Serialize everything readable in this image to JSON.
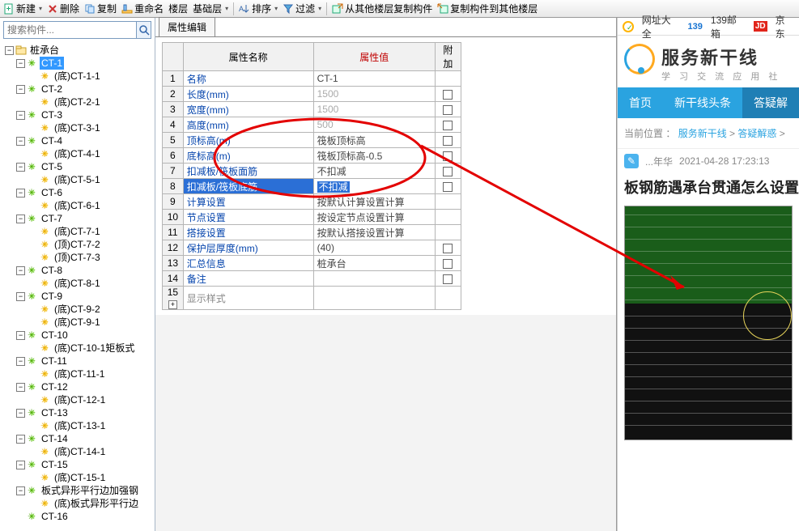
{
  "toolbar": {
    "new": "新建",
    "delete": "删除",
    "copy": "复制",
    "rename": "重命名",
    "floor": "楼层",
    "base_layer": "基础层",
    "sort": "排序",
    "filter": "过滤",
    "copy_from_other": "从其他楼层复制构件",
    "copy_to_other": "复制构件到其他楼层"
  },
  "search_placeholder": "搜索构件...",
  "tree_root": "桩承台",
  "tree": [
    {
      "lvl": 1,
      "tw": "-",
      "ic": "green",
      "label": "CT-1",
      "sel": true
    },
    {
      "lvl": 2,
      "tw": "",
      "ic": "orange",
      "label": "(底)CT-1-1"
    },
    {
      "lvl": 1,
      "tw": "-",
      "ic": "green",
      "label": "CT-2"
    },
    {
      "lvl": 2,
      "tw": "",
      "ic": "orange",
      "label": "(底)CT-2-1"
    },
    {
      "lvl": 1,
      "tw": "-",
      "ic": "green",
      "label": "CT-3"
    },
    {
      "lvl": 2,
      "tw": "",
      "ic": "orange",
      "label": "(底)CT-3-1"
    },
    {
      "lvl": 1,
      "tw": "-",
      "ic": "green",
      "label": "CT-4"
    },
    {
      "lvl": 2,
      "tw": "",
      "ic": "orange",
      "label": "(底)CT-4-1"
    },
    {
      "lvl": 1,
      "tw": "-",
      "ic": "green",
      "label": "CT-5"
    },
    {
      "lvl": 2,
      "tw": "",
      "ic": "orange",
      "label": "(底)CT-5-1"
    },
    {
      "lvl": 1,
      "tw": "-",
      "ic": "green",
      "label": "CT-6"
    },
    {
      "lvl": 2,
      "tw": "",
      "ic": "orange",
      "label": "(底)CT-6-1"
    },
    {
      "lvl": 1,
      "tw": "-",
      "ic": "green",
      "label": "CT-7"
    },
    {
      "lvl": 2,
      "tw": "",
      "ic": "orange",
      "label": "(底)CT-7-1"
    },
    {
      "lvl": 2,
      "tw": "",
      "ic": "orange",
      "label": "(顶)CT-7-2"
    },
    {
      "lvl": 2,
      "tw": "",
      "ic": "orange",
      "label": "(顶)CT-7-3"
    },
    {
      "lvl": 1,
      "tw": "-",
      "ic": "green",
      "label": "CT-8"
    },
    {
      "lvl": 2,
      "tw": "",
      "ic": "orange",
      "label": "(底)CT-8-1"
    },
    {
      "lvl": 1,
      "tw": "-",
      "ic": "green",
      "label": "CT-9"
    },
    {
      "lvl": 2,
      "tw": "",
      "ic": "orange",
      "label": "(底)CT-9-2"
    },
    {
      "lvl": 2,
      "tw": "",
      "ic": "orange",
      "label": "(底)CT-9-1"
    },
    {
      "lvl": 1,
      "tw": "-",
      "ic": "green",
      "label": "CT-10"
    },
    {
      "lvl": 2,
      "tw": "",
      "ic": "orange",
      "label": "(底)CT-10-1矩板式"
    },
    {
      "lvl": 1,
      "tw": "-",
      "ic": "green",
      "label": "CT-11"
    },
    {
      "lvl": 2,
      "tw": "",
      "ic": "orange",
      "label": "(底)CT-11-1"
    },
    {
      "lvl": 1,
      "tw": "-",
      "ic": "green",
      "label": "CT-12"
    },
    {
      "lvl": 2,
      "tw": "",
      "ic": "orange",
      "label": "(底)CT-12-1"
    },
    {
      "lvl": 1,
      "tw": "-",
      "ic": "green",
      "label": "CT-13"
    },
    {
      "lvl": 2,
      "tw": "",
      "ic": "orange",
      "label": "(底)CT-13-1"
    },
    {
      "lvl": 1,
      "tw": "-",
      "ic": "green",
      "label": "CT-14"
    },
    {
      "lvl": 2,
      "tw": "",
      "ic": "orange",
      "label": "(底)CT-14-1"
    },
    {
      "lvl": 1,
      "tw": "-",
      "ic": "green",
      "label": "CT-15"
    },
    {
      "lvl": 2,
      "tw": "",
      "ic": "orange",
      "label": "(底)CT-15-1"
    },
    {
      "lvl": 1,
      "tw": "-",
      "ic": "green",
      "label": "板式异形平行边加强钢"
    },
    {
      "lvl": 2,
      "tw": "",
      "ic": "orange",
      "label": "(底)板式异形平行边"
    },
    {
      "lvl": 1,
      "tw": "",
      "ic": "green",
      "label": "CT-16"
    }
  ],
  "tab_title": "属性编辑",
  "grid": {
    "headers": {
      "name": "属性名称",
      "value": "属性值",
      "add": "附加"
    },
    "rows": [
      {
        "n": "1",
        "name": "名称",
        "val": "CT-1",
        "chk": false
      },
      {
        "n": "2",
        "name": "长度(mm)",
        "val": "1500",
        "chk": true
      },
      {
        "n": "3",
        "name": "宽度(mm)",
        "val": "1500",
        "chk": true
      },
      {
        "n": "4",
        "name": "高度(mm)",
        "val": "500",
        "chk": true
      },
      {
        "n": "5",
        "name": "顶标高(m)",
        "val": "筏板顶标高",
        "chk": true
      },
      {
        "n": "6",
        "name": "底标高(m)",
        "val": "筏板顶标高-0.5",
        "chk": true
      },
      {
        "n": "7",
        "name": "扣减板/筏板面筋",
        "val": "不扣减",
        "chk": true
      },
      {
        "n": "8",
        "name": "扣减板/筏板底筋",
        "val": "不扣减",
        "chk": true,
        "sel": true
      },
      {
        "n": "9",
        "name": "计算设置",
        "val": "按默认计算设置计算",
        "chk": false
      },
      {
        "n": "10",
        "name": "节点设置",
        "val": "按设定节点设置计算",
        "chk": false
      },
      {
        "n": "11",
        "name": "搭接设置",
        "val": "按默认搭接设置计算",
        "chk": false
      },
      {
        "n": "12",
        "name": "保护层厚度(mm)",
        "val": "(40)",
        "chk": true
      },
      {
        "n": "13",
        "name": "汇总信息",
        "val": "桩承台",
        "chk": true
      },
      {
        "n": "14",
        "name": "备注",
        "val": "",
        "chk": true
      },
      {
        "n": "15",
        "name": "显示样式",
        "val": "",
        "chk": false,
        "plus": true
      }
    ]
  },
  "right": {
    "nav_fav": "网址大全",
    "nav_139": "139邮箱",
    "nav_jd": "京东",
    "logo_big": "服务新干线",
    "logo_sub": "学 习 交 流 应 用 社",
    "tabs": [
      "首页",
      "新干线头条",
      "答疑解"
    ],
    "crumb_prefix": "当前位置 ：",
    "crumb_a": "服务新干线",
    "crumb_b": "答疑解惑",
    "author": "...年华",
    "time": "2021-04-28 17:23:13",
    "title": "板钢筋遇承台贯通怎么设置"
  }
}
